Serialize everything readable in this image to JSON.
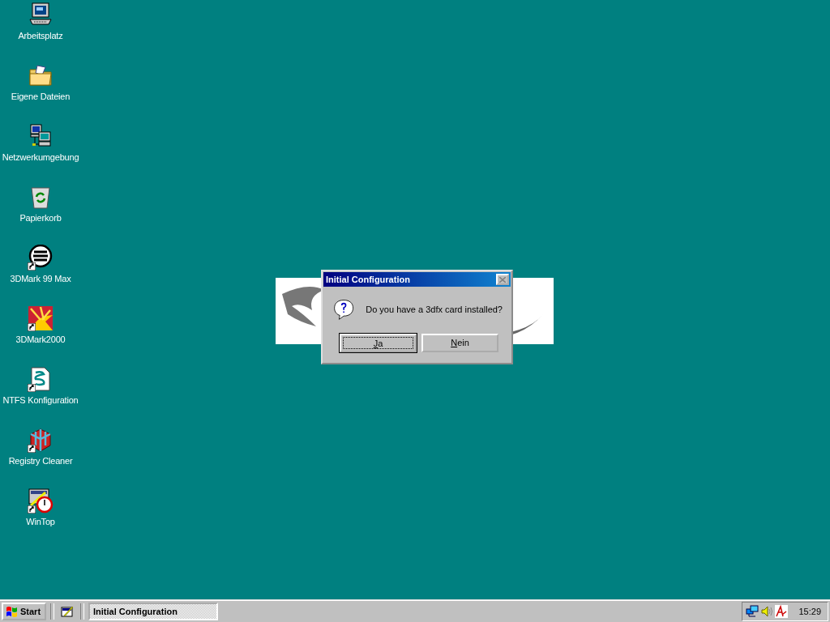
{
  "desktop_icons": [
    {
      "kind": "computer",
      "label": "Arbeitsplatz",
      "shortcut": false
    },
    {
      "kind": "folder",
      "label": "Eigene Dateien",
      "shortcut": false
    },
    {
      "kind": "network",
      "label": "Netzwerkumgebung",
      "shortcut": false
    },
    {
      "kind": "recycle-bin",
      "label": "Papierkorb",
      "shortcut": false
    },
    {
      "kind": "list-circle",
      "label": "3DMark 99 Max",
      "shortcut": true
    },
    {
      "kind": "starburst",
      "label": "3DMark2000",
      "shortcut": true
    },
    {
      "kind": "script",
      "label": "NTFS Konfiguration",
      "shortcut": true
    },
    {
      "kind": "cube",
      "label": "Registry Cleaner",
      "shortcut": true
    },
    {
      "kind": "stopwatch",
      "label": "WinTop",
      "shortcut": true
    }
  ],
  "dialog": {
    "title": "Initial Configuration",
    "close_disabled": true,
    "message": "Do you have a 3dfx card installed?",
    "buttons": [
      {
        "label": "Ja",
        "first_letter_underlined": true,
        "focused": true
      },
      {
        "label": "Nein",
        "first_letter_underlined": true,
        "focused": false
      }
    ]
  },
  "taskbar": {
    "start_label": "Start",
    "tasks": [
      {
        "label": "Initial Configuration",
        "selected": true
      }
    ],
    "clock": "15:29"
  }
}
